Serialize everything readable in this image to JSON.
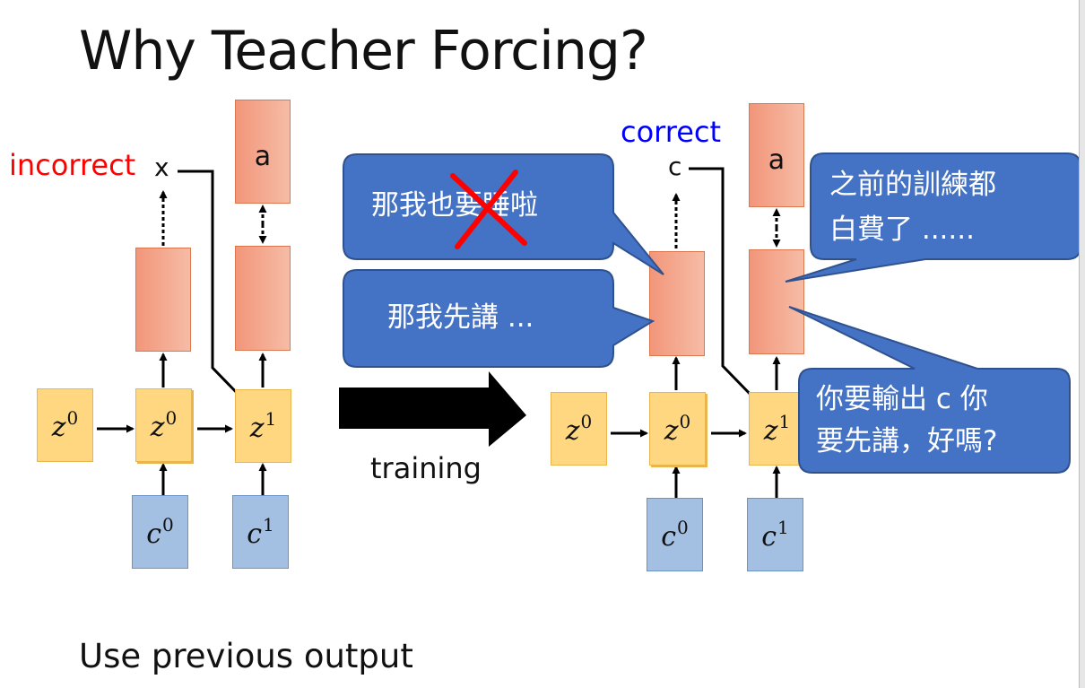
{
  "slide": {
    "title": "Why Teacher Forcing?",
    "footer": "Use previous output"
  },
  "left": {
    "incorrect_label": "incorrect",
    "output_x": "x",
    "output_a": "a",
    "z0_outer": {
      "base": "z",
      "sup": "0"
    },
    "z0_inner": {
      "base": "z",
      "sup": "0"
    },
    "z1": {
      "base": "z",
      "sup": "1"
    },
    "c0": {
      "base": "c",
      "sup": "0"
    },
    "c1": {
      "base": "c",
      "sup": "1"
    }
  },
  "arrow_label": "training",
  "right": {
    "correct_label": "correct",
    "output_c": "c",
    "output_a": "a",
    "z0_outer": {
      "base": "z",
      "sup": "0"
    },
    "z0_inner": {
      "base": "z",
      "sup": "0"
    },
    "z1": {
      "base": "z",
      "sup": "1"
    },
    "c0": {
      "base": "c",
      "sup": "0"
    },
    "c1": {
      "base": "c",
      "sup": "1"
    }
  },
  "bubbles": {
    "sleep": "那我也要睡啦",
    "speak_first": "那我先講 ...",
    "wasted_line1": "之前的訓練都",
    "wasted_line2": "白費了 ......",
    "ask_line1": "你要輸出 c 你",
    "ask_line2": "要先講，好嗎?"
  },
  "colors": {
    "incorrect": "#ff0000",
    "correct": "#0000ff",
    "bubble": "#4472c4",
    "cross": "#ff0000"
  }
}
